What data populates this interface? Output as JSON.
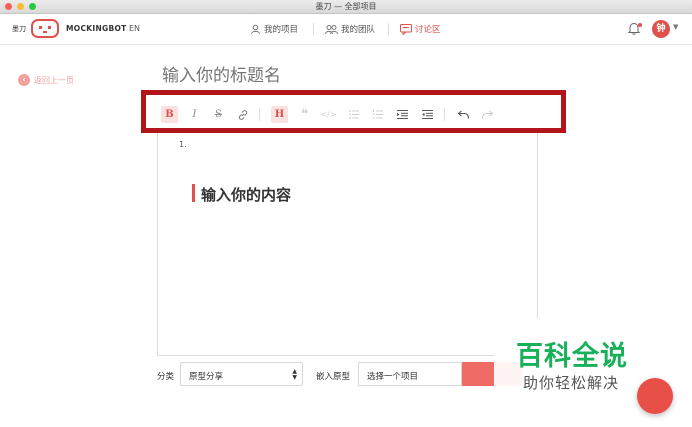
{
  "window": {
    "title": "墨刀 — 全部项目"
  },
  "nav": {
    "brand_cn": "墨刀",
    "brand_en": "MOCKINGBOT",
    "lang": "EN",
    "items": [
      {
        "label": "我的项目",
        "icon": "user-icon"
      },
      {
        "label": "我的团队",
        "icon": "team-icon"
      },
      {
        "label": "讨论区",
        "icon": "chat-icon",
        "active": true
      }
    ],
    "avatar_initial": "钟",
    "accent": "#e0514c"
  },
  "back": {
    "label": "返回上一页"
  },
  "editor": {
    "title_placeholder": "输入你的标题名",
    "list_number": "1.",
    "content_heading": "输入你的内容",
    "toolbar": [
      "bold",
      "italic",
      "strikethrough",
      "link",
      "heading",
      "quote",
      "code",
      "bullet-list",
      "numbered-list",
      "indent",
      "outdent",
      "undo",
      "redo"
    ],
    "highlight_color": "#b3141a"
  },
  "form": {
    "category_label": "分类",
    "category_value": "原型分享",
    "embed_label": "嵌入原型",
    "embed_value": "选择一个项目"
  },
  "watermark": {
    "big": "百科全说",
    "small": "助你轻松解决",
    "color": "#19b05a"
  }
}
